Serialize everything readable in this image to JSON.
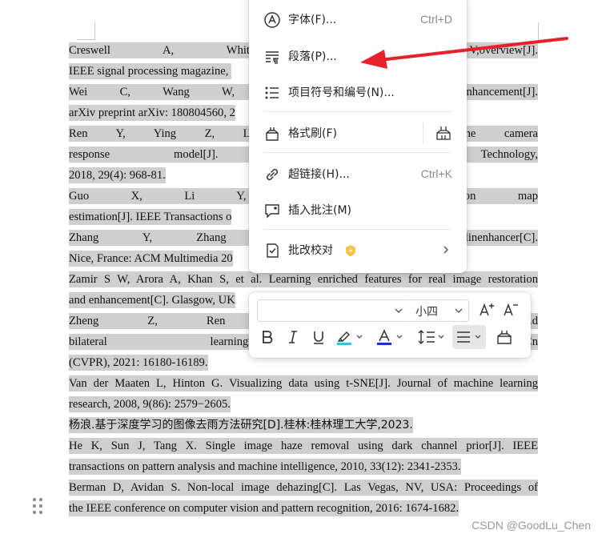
{
  "document": {
    "lines": [
      {
        "text": "Creswell A, White T, Dumoulin V,",
        "tail": "overview[J]."
      },
      {
        "text": "IEEE signal processing magazine, ",
        "tail": ""
      },
      {
        "text": "Wei C, Wang W, Yang W, et al. De",
        "tail": "nhancement[J]."
      },
      {
        "text": "arXiv preprint arXiv: 180804560, 2",
        "tail": ""
      },
      {
        "text": "Ren Y, Ying Z, Li TH, et al. LEC",
        "tail": "g the camera"
      },
      {
        "text": "response model[J]. IEEE Transact",
        "tail": "o Technology,"
      },
      {
        "text": "2018, 29(4): 968-81.",
        "tail": ""
      },
      {
        "text": "Guo X, Li Y, Ling H. LIME:",
        "tail": "nination map"
      },
      {
        "text": "estimation[J]. IEEE Transactions o",
        "tail": ""
      },
      {
        "text": "Zhang Y, Zhang J, Guo X. Kindlin",
        "tail": "enhancer[C]."
      },
      {
        "text": "Nice, France: ACM Multimedia 20",
        "tail": ""
      },
      {
        "text": "Zamir S W, Arora A, Khan S, et al. Learning enriched features for real image restoration",
        "tail": ""
      },
      {
        "text": "and enhancement[C]. Glasgow, UK",
        "tail": ""
      },
      {
        "text": "Zheng Z, Ren W, Cao X, et al.",
        "tail": "d"
      },
      {
        "text": "bilateral learning[C]. IEEE/CVF C",
        "tail": "n"
      },
      {
        "text": "(CVPR), 2021: 16180-16189.",
        "tail": ""
      },
      {
        "text": "Van der Maaten L, Hinton G. Visualizing data using t-SNE[J]. Journal of machine learning",
        "tail": ""
      },
      {
        "text": "research, 2008, 9(86): 2579−2605.",
        "tail": ""
      },
      {
        "text": "杨浪.基于深度学习的图像去雨方法研究[D].桂林:桂林理工大学,2023.",
        "tail": ""
      },
      {
        "text": "He K, Sun J, Tang X. Single image haze removal using dark channel prior[J]. IEEE",
        "tail": ""
      },
      {
        "text": "transactions on pattern analysis and machine intelligence, 2010, 33(12): 2341-2353.",
        "tail": ""
      },
      {
        "text": "Berman D, Avidan S. Non-local image dehazing[C]. Las Vegas, NV, USA: Proceedings of",
        "tail": ""
      },
      {
        "text": "the IEEE conference on computer vision and pattern recognition, 2016: 1674-1682.",
        "tail": ""
      }
    ]
  },
  "context_menu": {
    "items": [
      {
        "label": "字体(F)...",
        "shortcut": "Ctrl+D",
        "icon": "font-icon"
      },
      {
        "label": "段落(P)...",
        "shortcut": "",
        "icon": "paragraph-icon"
      },
      {
        "label": "项目符号和编号(N)...",
        "shortcut": "",
        "icon": "bullet-list-icon"
      },
      {
        "label": "格式刷(F)",
        "shortcut": "",
        "icon": "format-painter-icon"
      },
      {
        "label": "超链接(H)...",
        "shortcut": "Ctrl+K",
        "icon": "link-icon"
      },
      {
        "label": "插入批注(M)",
        "shortcut": "",
        "icon": "comment-icon"
      },
      {
        "label": "批改校对",
        "shortcut": "",
        "icon": "proofread-icon"
      }
    ]
  },
  "format_toolbar": {
    "font_name": "",
    "font_size": "小四"
  },
  "colors": {
    "highlight": "#cfcfcf",
    "annotation_arrow": "#e8202a",
    "highlighter_color": "#2ec3e6",
    "font_color": "#1f2ad6"
  },
  "watermark": "CSDN @GoodLu_Chen"
}
